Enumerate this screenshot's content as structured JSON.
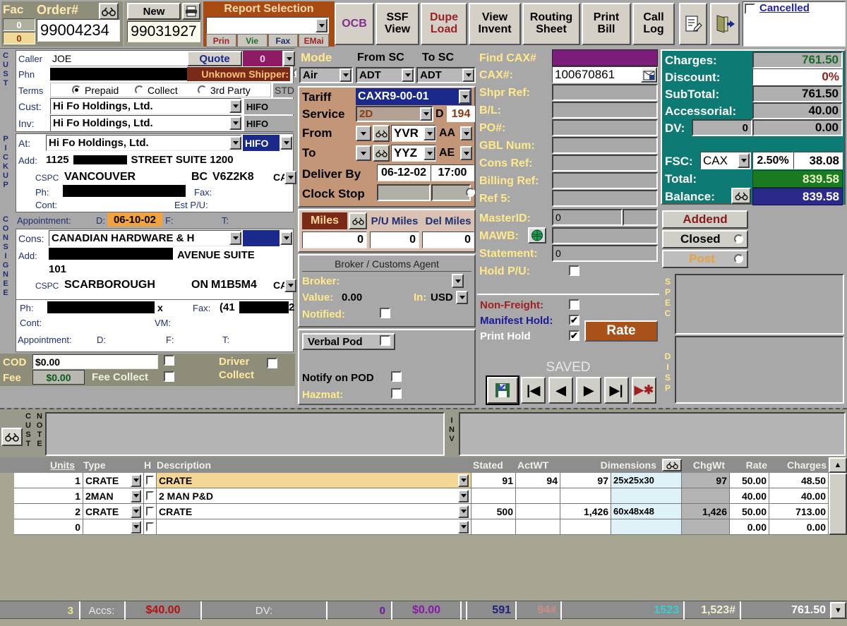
{
  "header": {
    "fac_label": "Fac",
    "order_label": "Order#",
    "fac_values": [
      "0",
      "0"
    ],
    "order_number": "99004234",
    "new_label": "New",
    "new_number": "99031927",
    "report_selection_label": "Report Selection",
    "report_selection_value": "",
    "report_buttons": [
      "Prin",
      "Vie",
      "Fax",
      "EMai"
    ],
    "buttons": [
      "OCB",
      "SSF View",
      "Dupe Load",
      "View Invent",
      "Routing Sheet",
      "Print Bill",
      "Call Log"
    ],
    "ocb": "OCB",
    "ssf_view": [
      "SSF",
      "View"
    ],
    "dupe_load": [
      "Dupe",
      "Load"
    ],
    "view_invent": [
      "View",
      "Invent"
    ],
    "routing_sheet": [
      "Routing",
      "Sheet"
    ],
    "print_bill": [
      "Print",
      "Bill"
    ],
    "call_log": [
      "Call",
      "Log"
    ],
    "cancelled_label": "Cancelled",
    "cancelled_checked": false,
    "cancelled_note": ""
  },
  "customer": {
    "section_label": "CUST",
    "caller_label": "Caller",
    "caller_value": "JOE",
    "phone_label": "Phn",
    "phone_value": "",
    "quote_label": "Quote",
    "quote_value": "0",
    "unknown_shipper_label": "Unknown Shipper:",
    "unknown_shipper_checked": false,
    "terms_label": "Terms",
    "terms_options": [
      "Prepaid",
      "Collect",
      "3rd Party"
    ],
    "terms_selected": "Prepaid",
    "terms_code": "STD",
    "cust_label": "Cust:",
    "cust_value": "Hi Fo Holdings, Ltd.",
    "cust_code": "HIFO",
    "inv_label": "Inv:",
    "inv_value": "Hi Fo Holdings, Ltd.",
    "inv_code": "HIFO"
  },
  "pickup": {
    "section_label": "PICKUP",
    "at_label": "At:",
    "at_value": "Hi Fo Holdings, Ltd.",
    "at_code": "HIFO",
    "add_label": "Add:",
    "add_value": "1125",
    "add_value2": "STREET SUITE 1200",
    "cspc_label": "CSPC",
    "city": "VANCOUVER",
    "prov": "BC",
    "postal": "V6Z2K8",
    "country": "CA",
    "ph_label": "Ph:",
    "ph_value": "",
    "fax_label": "Fax:",
    "fax_value": "",
    "cont_label": "Cont:",
    "cont_value": "",
    "est_pu_label": "Est P/U:",
    "est_pu_value": "",
    "appt_label": "Appointment:",
    "appt_d_label": "D:",
    "appt_d_value": "06-10-02",
    "appt_f_label": "F:",
    "appt_f_value": "",
    "appt_t_label": "T:",
    "appt_t_value": ""
  },
  "consignee": {
    "section_label": "CONSIGNEE",
    "cons_label": "Cons:",
    "cons_value": "CANADIAN HARDWARE & H",
    "cons_code": "",
    "add_label": "Add:",
    "add_value": "AVENUE SUITE",
    "add_value2": "101",
    "cspc_label": "CSPC",
    "city": "SCARBOROUGH",
    "prov": "ON",
    "postal": "M1B5M4",
    "country": "CA",
    "ph_label": "Ph:",
    "ph_ext": "x",
    "fax_label": "Fax:",
    "fax_value": "(41",
    "fax_value2": "2",
    "cont_label": "Cont:",
    "vm_label": "VM:",
    "appt_label": "Appointment:",
    "appt_d_label": "D:",
    "appt_f_label": "F:",
    "appt_t_label": "T:"
  },
  "cod": {
    "cod_label": "COD",
    "cod_value": "$0.00",
    "cod_checked": false,
    "fee_label": "Fee",
    "fee_value": "$0.00",
    "fee_collect_label": "Fee Collect",
    "fee_collect_checked": false,
    "driver_collect_label": "Driver Collect",
    "driver_collect_checked": false
  },
  "mode": {
    "mode_label": "Mode",
    "from_sc_label": "From SC",
    "to_sc_label": "To SC",
    "mode_value": "Air",
    "from_sc_value": "ADT",
    "to_sc_value": "ADT",
    "tariff_label": "Tariff",
    "tariff_value": "CAXR9-00-01",
    "service_label": "Service",
    "service_value": "2D",
    "service_d_label": "D",
    "service_d_value": "194",
    "from_label": "From",
    "from_value": "YVR",
    "from_type": "AA",
    "to_label": "To",
    "to_value": "YYZ",
    "to_type": "AE",
    "deliver_by_label": "Deliver By",
    "deliver_by_date": "06-12-02",
    "deliver_by_time": "17:00",
    "clock_stop_label": "Clock Stop",
    "clock_stop_date": "",
    "clock_stop_time": ""
  },
  "miles": {
    "miles_label": "Miles",
    "miles_value": "0",
    "pu_miles_label": "P/U Miles",
    "pu_miles_value": "0",
    "del_miles_label": "Del Miles",
    "del_miles_value": "0"
  },
  "broker": {
    "title": "Broker / Customs Agent",
    "broker_label": "Broker:",
    "broker_value": "",
    "value_label": "Value:",
    "value_value": "0.00",
    "in_label": "In:",
    "in_value": "USD",
    "notified_label": "Notified:",
    "notified_checked": false,
    "verbal_pod_label": "Verbal Pod",
    "verbal_pod_checked": false,
    "notify_on_pod_label": "Notify on POD",
    "notify_on_pod_checked": false,
    "hazmat_label": "Hazmat:",
    "hazmat_checked": false
  },
  "refs": {
    "find_cax_label": "Find CAX#",
    "find_cax_value": "",
    "cax_label": "CAX#:",
    "cax_value": "100670861",
    "shpr_ref_label": "Shpr Ref:",
    "shpr_ref_value": "",
    "bl_label": "B/L:",
    "bl_value": "",
    "po_label": "PO#:",
    "po_value": "",
    "gbl_label": "GBL Num:",
    "gbl_value": "",
    "cons_ref_label": "Cons Ref:",
    "cons_ref_value": "",
    "billing_ref_label": "Billing Ref:",
    "billing_ref_value": "",
    "ref5_label": "Ref 5:",
    "ref5_value": "",
    "master_id_label": "MasterID:",
    "master_id_value": "0",
    "mawb_label": "MAWB:",
    "mawb_value": "",
    "statement_label": "Statement:",
    "statement_value": "0",
    "hold_pu_label": "Hold P/U:",
    "hold_pu_checked": false
  },
  "flags": {
    "non_freight_label": "Non-Freight:",
    "non_freight_checked": false,
    "manifest_hold_label": "Manifest Hold:",
    "manifest_hold_checked": true,
    "print_hold_label": "Print Hold",
    "print_hold_checked": true,
    "rate_label": "Rate"
  },
  "nav": {
    "status": "SAVED",
    "save_icon": "save-disk-icon",
    "first": "|◀",
    "prev": "◀",
    "next": "▶",
    "last": "▶|",
    "new_record": "▶✱"
  },
  "charges": {
    "charges_label": "Charges:",
    "charges_value": "761.50",
    "discount_label": "Discount:",
    "discount_value": "0%",
    "subtotal_label": "SubTotal:",
    "subtotal_value": "761.50",
    "accessorial_label": "Accessorial:",
    "accessorial_value": "40.00",
    "dv_label": "DV:",
    "dv_units": "0",
    "dv_value": "0.00",
    "fsc_label": "FSC:",
    "fsc_code": "CAX",
    "fsc_pct": "2.50%",
    "fsc_value": "38.08",
    "total_label": "Total:",
    "total_value": "839.58",
    "balance_label": "Balance:",
    "balance_value": "839.58"
  },
  "status_buttons": {
    "addend": "Addend",
    "closed": "Closed",
    "closed_checked": false,
    "post": "Post",
    "post_checked": false
  },
  "spec": {
    "section_label": "SPEC",
    "disp_label": "DISP",
    "spec_value": "",
    "disp_value": ""
  },
  "notes": {
    "cust_label": "CUST",
    "note_label": "NOTE",
    "cust_note_value": "",
    "inv_label": "INV",
    "inv_note_value": ""
  },
  "items": {
    "columns": [
      "Units",
      "Type",
      "H",
      "Description",
      "Stated",
      "ActWT",
      "Dimensions",
      "ChgWt",
      "Rate",
      "Charges"
    ],
    "dimensions_icon": "glasses-icon",
    "rows": [
      {
        "marker": "▶",
        "units": "1",
        "type": "CRATE",
        "h": false,
        "description": "CRATE",
        "stated": "91",
        "actwt": "94",
        "cuft": "97",
        "dimensions": "25x25x30",
        "chgwt": "97",
        "rate": "50.00",
        "charges": "48.50",
        "selected": true
      },
      {
        "marker": "",
        "units": "1",
        "type": "2MAN",
        "h": false,
        "description": "2 MAN P&D",
        "stated": "",
        "actwt": "",
        "cuft": "",
        "dimensions": "",
        "chgwt": "",
        "rate": "40.00",
        "charges": "40.00",
        "selected": false
      },
      {
        "marker": "",
        "units": "2",
        "type": "CRATE",
        "h": false,
        "description": "CRATE",
        "stated": "500",
        "actwt": "",
        "cuft": "1,426",
        "dimensions": "60x48x48",
        "chgwt": "1,426",
        "rate": "50.00",
        "charges": "713.00",
        "selected": false
      },
      {
        "marker": "✱",
        "units": "0",
        "type": "",
        "h": false,
        "description": "",
        "stated": "",
        "actwt": "",
        "cuft": "",
        "dimensions": "",
        "chgwt": "",
        "rate": "0.00",
        "charges": "0.00",
        "selected": false
      }
    ]
  },
  "totals": {
    "units": "3",
    "accs_label": "Accs:",
    "accs_value": "$40.00",
    "dv_label": "DV:",
    "dv_units": "0",
    "dv_value": "$0.00",
    "stated": "591",
    "actwt": "94#",
    "blank": "",
    "cuft": "1523",
    "chgwt": "1,523#",
    "rate": "",
    "charges": "761.50"
  }
}
